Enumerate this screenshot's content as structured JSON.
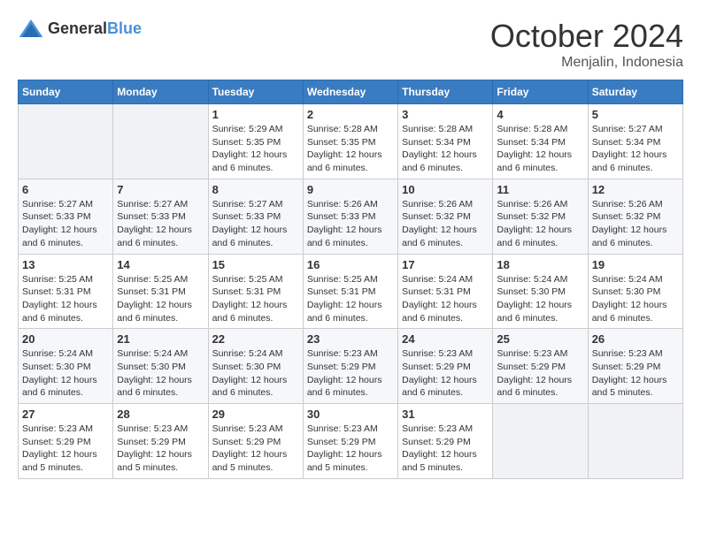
{
  "logo": {
    "text_general": "General",
    "text_blue": "Blue"
  },
  "header": {
    "month": "October 2024",
    "location": "Menjalin, Indonesia"
  },
  "weekdays": [
    "Sunday",
    "Monday",
    "Tuesday",
    "Wednesday",
    "Thursday",
    "Friday",
    "Saturday"
  ],
  "weeks": [
    [
      {
        "day": "",
        "info": ""
      },
      {
        "day": "",
        "info": ""
      },
      {
        "day": "1",
        "info": "Sunrise: 5:29 AM\nSunset: 5:35 PM\nDaylight: 12 hours and 6 minutes."
      },
      {
        "day": "2",
        "info": "Sunrise: 5:28 AM\nSunset: 5:35 PM\nDaylight: 12 hours and 6 minutes."
      },
      {
        "day": "3",
        "info": "Sunrise: 5:28 AM\nSunset: 5:34 PM\nDaylight: 12 hours and 6 minutes."
      },
      {
        "day": "4",
        "info": "Sunrise: 5:28 AM\nSunset: 5:34 PM\nDaylight: 12 hours and 6 minutes."
      },
      {
        "day": "5",
        "info": "Sunrise: 5:27 AM\nSunset: 5:34 PM\nDaylight: 12 hours and 6 minutes."
      }
    ],
    [
      {
        "day": "6",
        "info": "Sunrise: 5:27 AM\nSunset: 5:33 PM\nDaylight: 12 hours and 6 minutes."
      },
      {
        "day": "7",
        "info": "Sunrise: 5:27 AM\nSunset: 5:33 PM\nDaylight: 12 hours and 6 minutes."
      },
      {
        "day": "8",
        "info": "Sunrise: 5:27 AM\nSunset: 5:33 PM\nDaylight: 12 hours and 6 minutes."
      },
      {
        "day": "9",
        "info": "Sunrise: 5:26 AM\nSunset: 5:33 PM\nDaylight: 12 hours and 6 minutes."
      },
      {
        "day": "10",
        "info": "Sunrise: 5:26 AM\nSunset: 5:32 PM\nDaylight: 12 hours and 6 minutes."
      },
      {
        "day": "11",
        "info": "Sunrise: 5:26 AM\nSunset: 5:32 PM\nDaylight: 12 hours and 6 minutes."
      },
      {
        "day": "12",
        "info": "Sunrise: 5:26 AM\nSunset: 5:32 PM\nDaylight: 12 hours and 6 minutes."
      }
    ],
    [
      {
        "day": "13",
        "info": "Sunrise: 5:25 AM\nSunset: 5:31 PM\nDaylight: 12 hours and 6 minutes."
      },
      {
        "day": "14",
        "info": "Sunrise: 5:25 AM\nSunset: 5:31 PM\nDaylight: 12 hours and 6 minutes."
      },
      {
        "day": "15",
        "info": "Sunrise: 5:25 AM\nSunset: 5:31 PM\nDaylight: 12 hours and 6 minutes."
      },
      {
        "day": "16",
        "info": "Sunrise: 5:25 AM\nSunset: 5:31 PM\nDaylight: 12 hours and 6 minutes."
      },
      {
        "day": "17",
        "info": "Sunrise: 5:24 AM\nSunset: 5:31 PM\nDaylight: 12 hours and 6 minutes."
      },
      {
        "day": "18",
        "info": "Sunrise: 5:24 AM\nSunset: 5:30 PM\nDaylight: 12 hours and 6 minutes."
      },
      {
        "day": "19",
        "info": "Sunrise: 5:24 AM\nSunset: 5:30 PM\nDaylight: 12 hours and 6 minutes."
      }
    ],
    [
      {
        "day": "20",
        "info": "Sunrise: 5:24 AM\nSunset: 5:30 PM\nDaylight: 12 hours and 6 minutes."
      },
      {
        "day": "21",
        "info": "Sunrise: 5:24 AM\nSunset: 5:30 PM\nDaylight: 12 hours and 6 minutes."
      },
      {
        "day": "22",
        "info": "Sunrise: 5:24 AM\nSunset: 5:30 PM\nDaylight: 12 hours and 6 minutes."
      },
      {
        "day": "23",
        "info": "Sunrise: 5:23 AM\nSunset: 5:29 PM\nDaylight: 12 hours and 6 minutes."
      },
      {
        "day": "24",
        "info": "Sunrise: 5:23 AM\nSunset: 5:29 PM\nDaylight: 12 hours and 6 minutes."
      },
      {
        "day": "25",
        "info": "Sunrise: 5:23 AM\nSunset: 5:29 PM\nDaylight: 12 hours and 6 minutes."
      },
      {
        "day": "26",
        "info": "Sunrise: 5:23 AM\nSunset: 5:29 PM\nDaylight: 12 hours and 5 minutes."
      }
    ],
    [
      {
        "day": "27",
        "info": "Sunrise: 5:23 AM\nSunset: 5:29 PM\nDaylight: 12 hours and 5 minutes."
      },
      {
        "day": "28",
        "info": "Sunrise: 5:23 AM\nSunset: 5:29 PM\nDaylight: 12 hours and 5 minutes."
      },
      {
        "day": "29",
        "info": "Sunrise: 5:23 AM\nSunset: 5:29 PM\nDaylight: 12 hours and 5 minutes."
      },
      {
        "day": "30",
        "info": "Sunrise: 5:23 AM\nSunset: 5:29 PM\nDaylight: 12 hours and 5 minutes."
      },
      {
        "day": "31",
        "info": "Sunrise: 5:23 AM\nSunset: 5:29 PM\nDaylight: 12 hours and 5 minutes."
      },
      {
        "day": "",
        "info": ""
      },
      {
        "day": "",
        "info": ""
      }
    ]
  ]
}
